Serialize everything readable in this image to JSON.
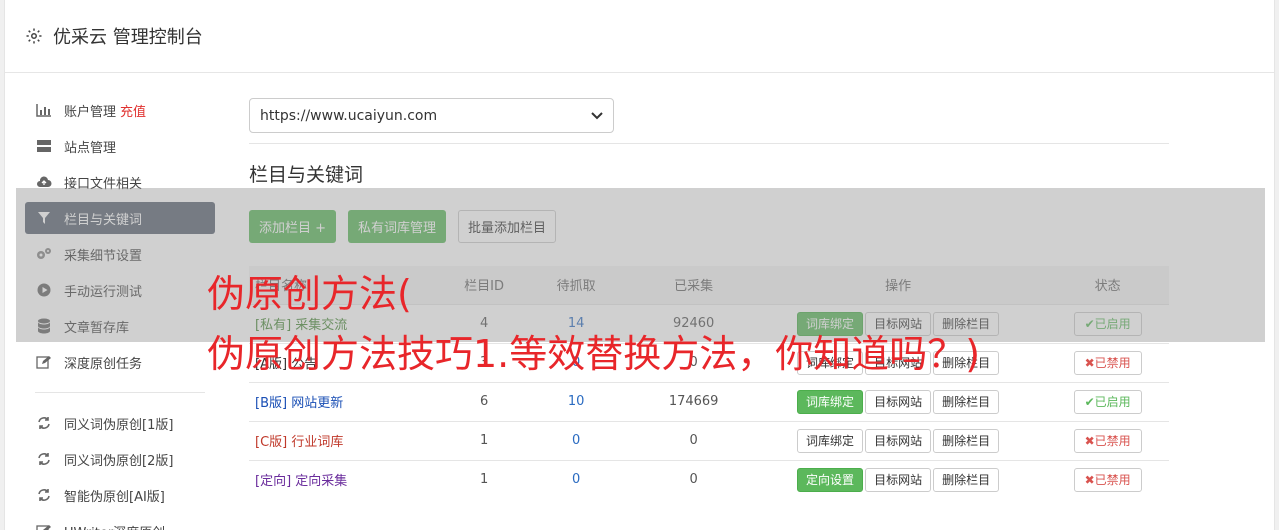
{
  "header": {
    "title": "优采云 管理控制台"
  },
  "sidebar": {
    "items": [
      {
        "label": "账户管理",
        "extra": "充值",
        "icon": "bar-chart-icon"
      },
      {
        "label": "站点管理",
        "icon": "server-icon"
      },
      {
        "label": "接口文件相关",
        "icon": "cloud-upload-icon"
      },
      {
        "label": "栏目与关键词",
        "icon": "filter-icon",
        "active": true
      },
      {
        "label": "采集细节设置",
        "icon": "gears-icon"
      },
      {
        "label": "手动运行测试",
        "icon": "play-icon"
      },
      {
        "label": "文章暂存库",
        "icon": "database-icon"
      },
      {
        "label": "深度原创任务",
        "icon": "edit-icon"
      }
    ],
    "items2": [
      {
        "label": "同义词伪原创[1版]",
        "icon": "refresh-icon"
      },
      {
        "label": "同义词伪原创[2版]",
        "icon": "refresh-icon"
      },
      {
        "label": "智能伪原创[AI版]",
        "icon": "refresh-icon"
      },
      {
        "label": "UWriter深度原创",
        "icon": "edit-icon"
      }
    ]
  },
  "main": {
    "site_select": "https://www.ucaiyun.com",
    "section_title": "栏目与关键词",
    "buttons": {
      "add": "添加栏目 +",
      "private_lib": "私有词库管理",
      "batch_add": "批量添加栏目"
    },
    "table": {
      "headers": [
        "栏目名称",
        "栏目ID",
        "待抓取",
        "已采集",
        "操作",
        "状态"
      ],
      "rows": [
        {
          "tag": "[私有]",
          "name": "采集交流",
          "id": "4",
          "pending": "14",
          "collected": "92460",
          "op1": "词库绑定",
          "op2": "目标网站",
          "op3": "删除栏目",
          "status": "已启用",
          "on": true,
          "color": "#4a8a3a",
          "op1green": true
        },
        {
          "tag": "[A版]",
          "name": "公告",
          "id": "3",
          "pending": "0",
          "collected": "0",
          "op1": "词库绑定",
          "op2": "目标网站",
          "op3": "删除栏目",
          "status": "已禁用",
          "on": false,
          "color": "#333",
          "op1green": false
        },
        {
          "tag": "[B版]",
          "name": "网站更新",
          "id": "6",
          "pending": "10",
          "collected": "174669",
          "op1": "词库绑定",
          "op2": "目标网站",
          "op3": "删除栏目",
          "status": "已启用",
          "on": true,
          "color": "#1a4fb5",
          "op1green": true
        },
        {
          "tag": "[C版]",
          "name": "行业词库",
          "id": "1",
          "pending": "0",
          "collected": "0",
          "op1": "词库绑定",
          "op2": "目标网站",
          "op3": "删除栏目",
          "status": "已禁用",
          "on": false,
          "color": "#c0392b",
          "op1green": false
        },
        {
          "tag": "[定向]",
          "name": "定向采集",
          "id": "1",
          "pending": "0",
          "collected": "0",
          "op1": "定向设置",
          "op2": "目标网站",
          "op3": "删除栏目",
          "status": "已禁用",
          "on": false,
          "color": "#6a2c9c",
          "op1green": true
        }
      ]
    }
  },
  "watermark": {
    "line1": "伪原创方法(",
    "line2": "伪原创方法技巧1.等效替换方法，你知道吗？)"
  }
}
